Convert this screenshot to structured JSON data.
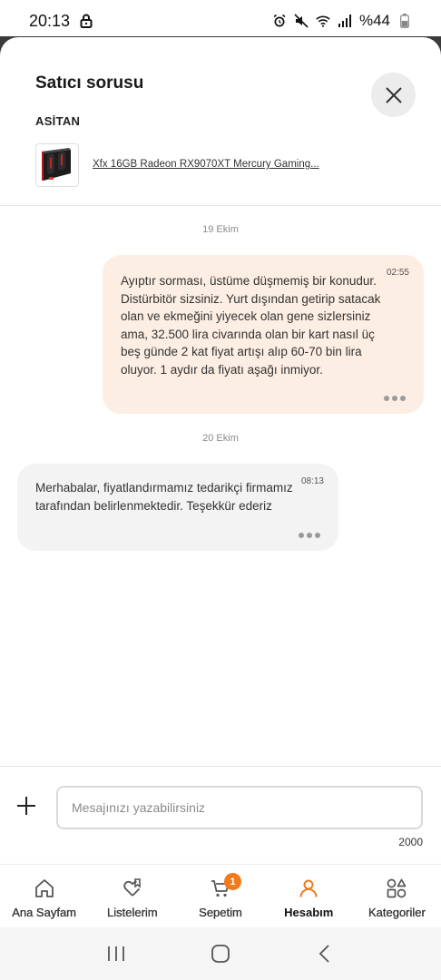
{
  "status": {
    "time": "20:13",
    "battery": "%44"
  },
  "header": {
    "title": "Satıcı sorusu",
    "seller": "ASİTAN",
    "product_name": "Xfx 16GB Radeon RX9070XT Mercury Gaming..."
  },
  "chat": {
    "messages": [
      {
        "date": "19 Ekim",
        "time": "02:55",
        "text": "Ayıptır sorması, üstüme düşmemiş bir konudur. Distürbitör sizsiniz. Yurt dışından getirip satacak olan ve ekmeğini yiyecek olan gene sizlersiniz ama, 32.500 lira civarında olan bir kart nasıl üç beş günde 2 kat fiyat artışı alıp 60-70 bin lira oluyor. 1 aydır da fiyatı aşağı inmiyor."
      },
      {
        "date": "20 Ekim",
        "time": "08:13",
        "text": "Merhabalar, fiyatlandırmamız tedarikçi firmamız tarafından belirlenmektedir. Teşekkür ederiz"
      }
    ]
  },
  "composer": {
    "placeholder": "Mesajınızı yazabilirsiniz",
    "char_limit": "2000"
  },
  "nav": {
    "items": [
      {
        "label": "Ana Sayfam",
        "icon": "home-icon"
      },
      {
        "label": "Listelerim",
        "icon": "heart-list-icon"
      },
      {
        "label": "Sepetim",
        "icon": "cart-icon",
        "badge": "1"
      },
      {
        "label": "Hesabım",
        "icon": "user-icon",
        "active": true
      },
      {
        "label": "Kategoriler",
        "icon": "categories-icon"
      }
    ]
  },
  "colors": {
    "accent": "#f27a1a",
    "outgoing_bubble": "#fdeee3",
    "incoming_bubble": "#f3f3f3"
  }
}
